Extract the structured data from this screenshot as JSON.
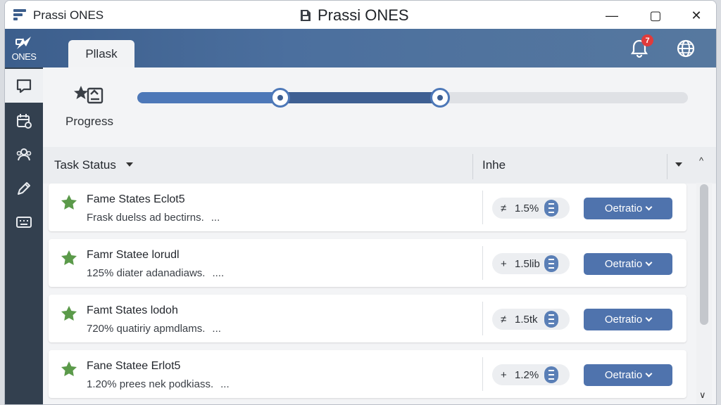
{
  "window": {
    "app_name": "Prassi ONES",
    "title": "Prassi ONES",
    "controls": {
      "minimize": "—",
      "maximize": "▢",
      "close": "✕"
    }
  },
  "topbar": {
    "brand_label": "ONES",
    "active_tab": "Pllask",
    "notification_count": "7"
  },
  "sidebar": {
    "items": [
      {
        "icon": "chat-icon",
        "active": true
      },
      {
        "icon": "calendar-icon",
        "active": false
      },
      {
        "icon": "team-icon",
        "active": false
      },
      {
        "icon": "pencil-icon",
        "active": false
      },
      {
        "icon": "keyboard-icon",
        "active": false
      }
    ]
  },
  "progress": {
    "label": "Progress",
    "segment1_end": 0.26,
    "segment2_end": 0.55
  },
  "table": {
    "header_status": "Task Status",
    "header_col2": "Inhe",
    "rows": [
      {
        "title": "Fame States Eclot5",
        "desc": "Frask duelss ad bectirns.",
        "dots": "...",
        "glyph": "≠",
        "pill_value": "1.5%",
        "action": "Oetratio"
      },
      {
        "title": "Famr Statee lorudl",
        "desc": "125% diater adanadiaws.",
        "dots": "....",
        "glyph": "+",
        "pill_value": "1.5lib",
        "action": "Oetratio"
      },
      {
        "title": "Famt States lodoh",
        "desc": "720% quatiriy apmdlams.",
        "dots": "...",
        "glyph": "≠",
        "pill_value": "1.5tk",
        "action": "Oetratio"
      },
      {
        "title": "Fane Statee Erlot5",
        "desc": "1.20% prees nek podkiass.",
        "dots": "...",
        "glyph": "+",
        "pill_value": "1.2%",
        "action": "Oetratio"
      }
    ]
  },
  "colors": {
    "topbar": "#4b6f9e",
    "sidebar": "#33404f",
    "accent": "#4f73ad",
    "star": "#5b9a4a",
    "badge": "#e03b3b"
  }
}
